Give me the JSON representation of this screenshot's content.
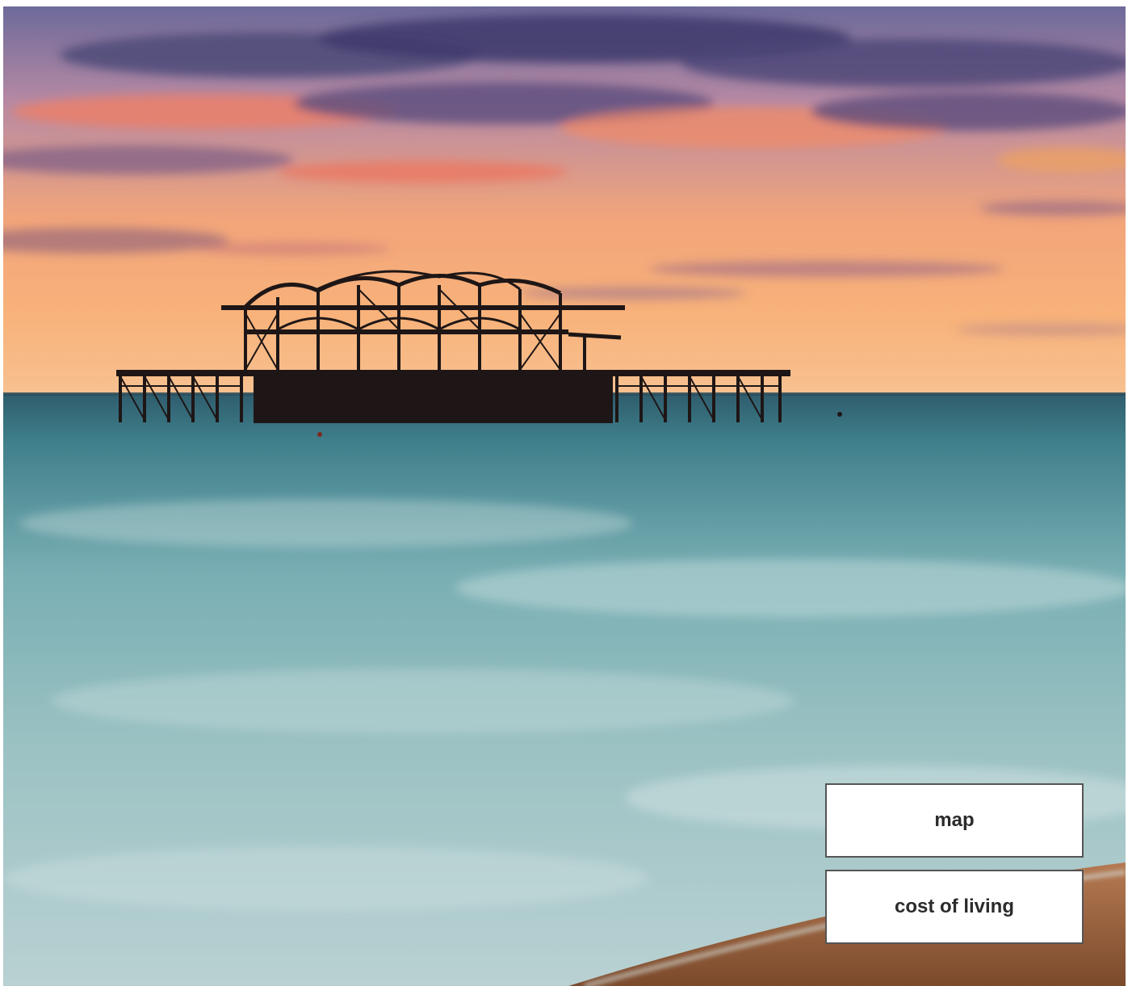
{
  "hero": {
    "image_subject": "sunset over the sea with ruined pier silhouette and pebble beach",
    "icon": "photo"
  },
  "buttons": {
    "map_label": "map",
    "cost_of_living_label": "cost of living"
  },
  "colors": {
    "button_background": "#ffffff",
    "button_border": "#555555",
    "button_text": "#2b2b2b"
  }
}
